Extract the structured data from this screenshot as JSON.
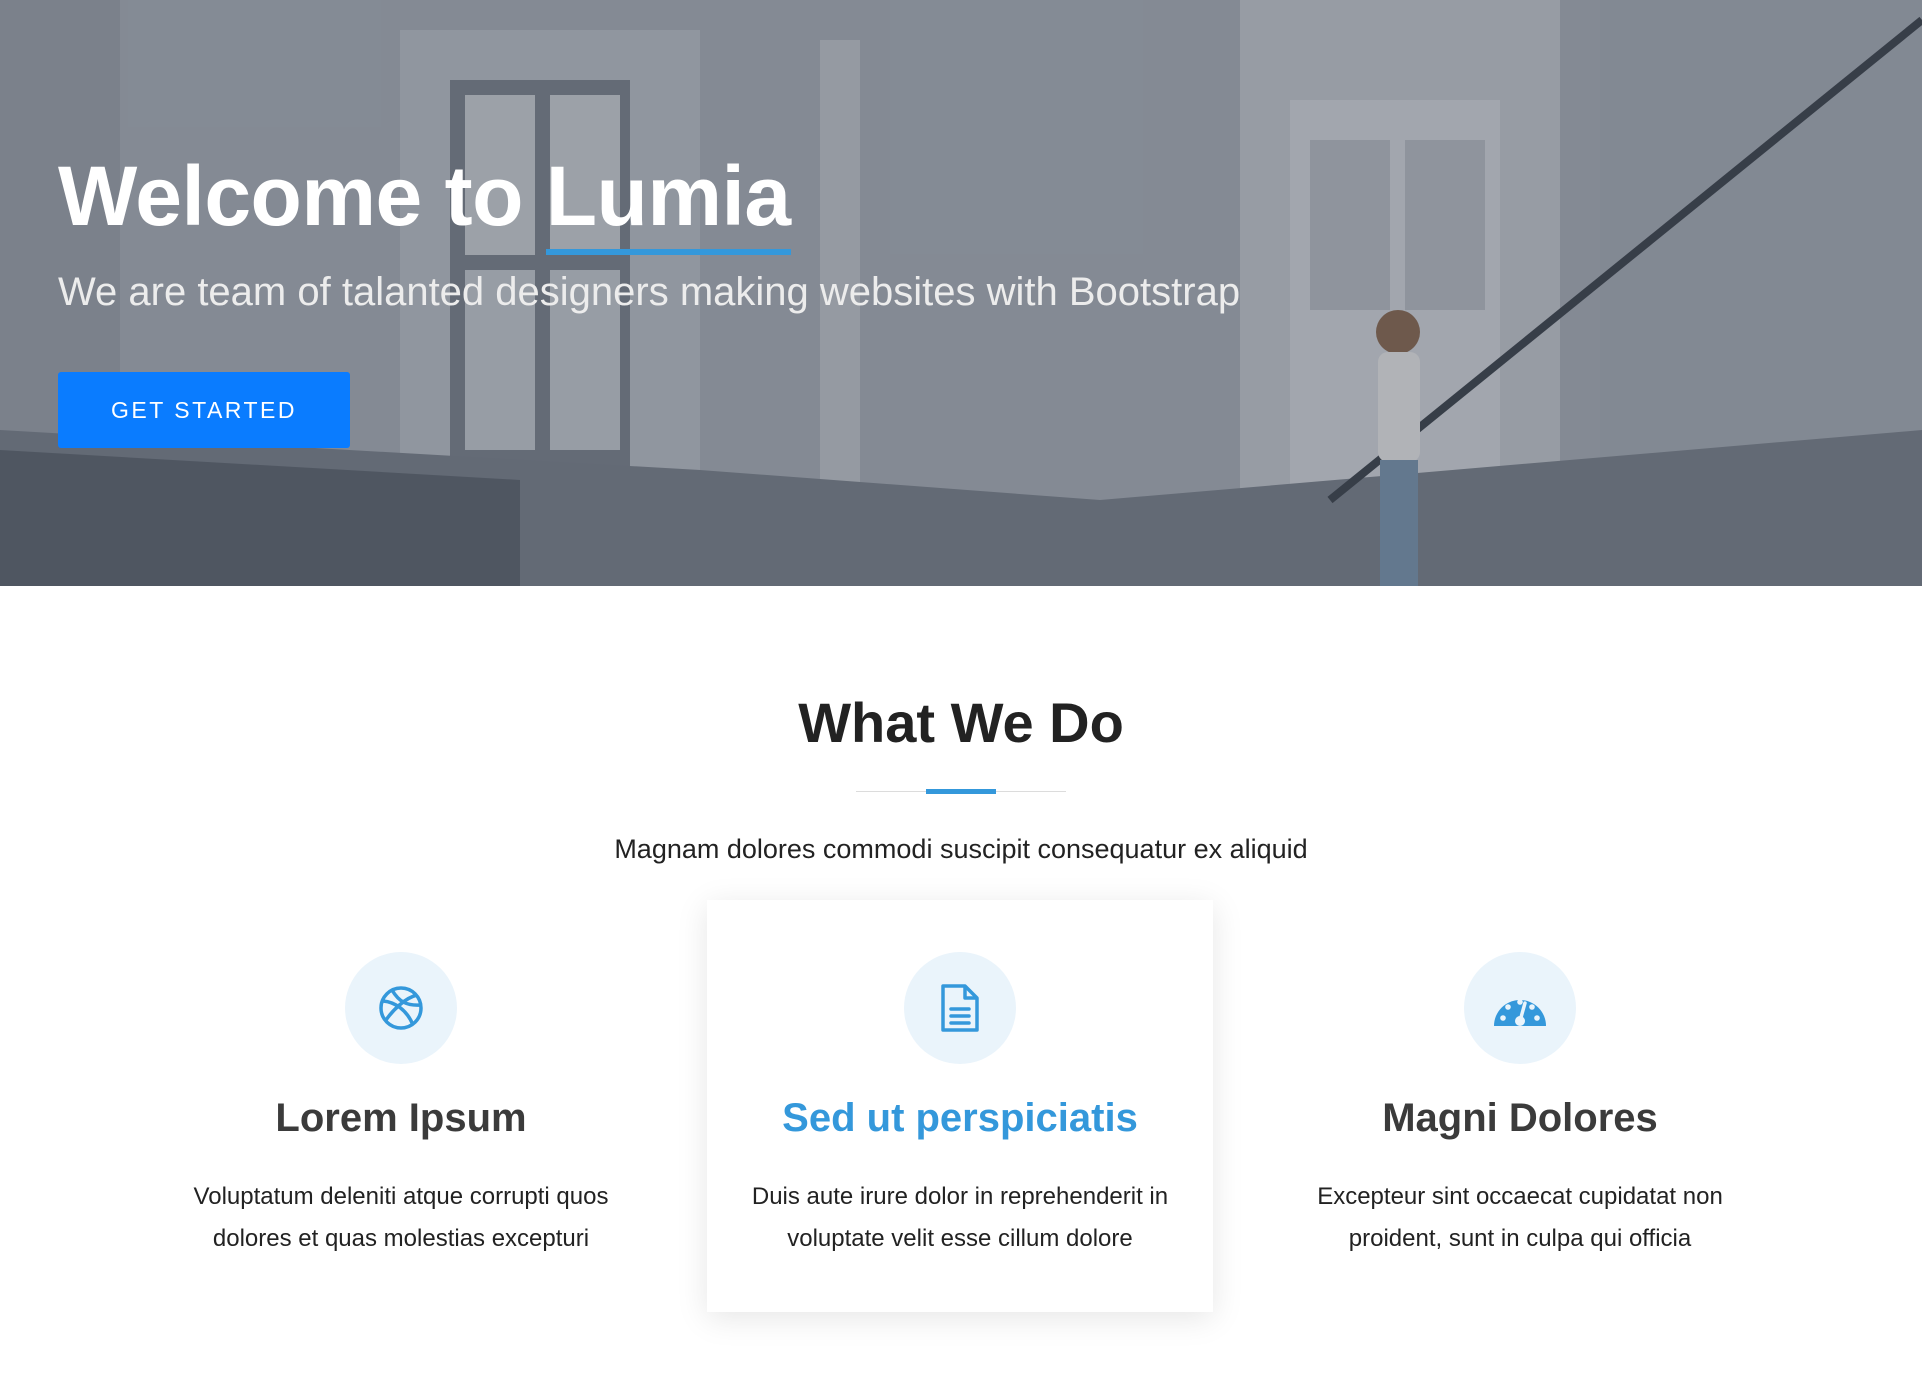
{
  "hero": {
    "title_prefix": "Welcome to ",
    "title_accent": "Lumia",
    "subtitle": "We are team of talanted designers making websites with Bootstrap",
    "cta_label": "GET STARTED"
  },
  "section": {
    "title": "What We Do",
    "description": "Magnam dolores commodi suscipit consequatur ex aliquid"
  },
  "services": [
    {
      "icon": "basketball-icon",
      "title": "Lorem Ipsum",
      "text": "Voluptatum deleniti atque corrupti quos dolores et quas molestias excepturi"
    },
    {
      "icon": "document-icon",
      "title": "Sed ut perspiciatis",
      "text": "Duis aute irure dolor in reprehenderit in voluptate velit esse cillum dolore"
    },
    {
      "icon": "speedometer-icon",
      "title": "Magni Dolores",
      "text": "Excepteur sint occaecat cupidatat non proident, sunt in culpa qui officia"
    }
  ],
  "colors": {
    "accent": "#3498db",
    "button": "#0a7cff",
    "icon_bg": "#eaf4fb",
    "heading": "#222222"
  }
}
